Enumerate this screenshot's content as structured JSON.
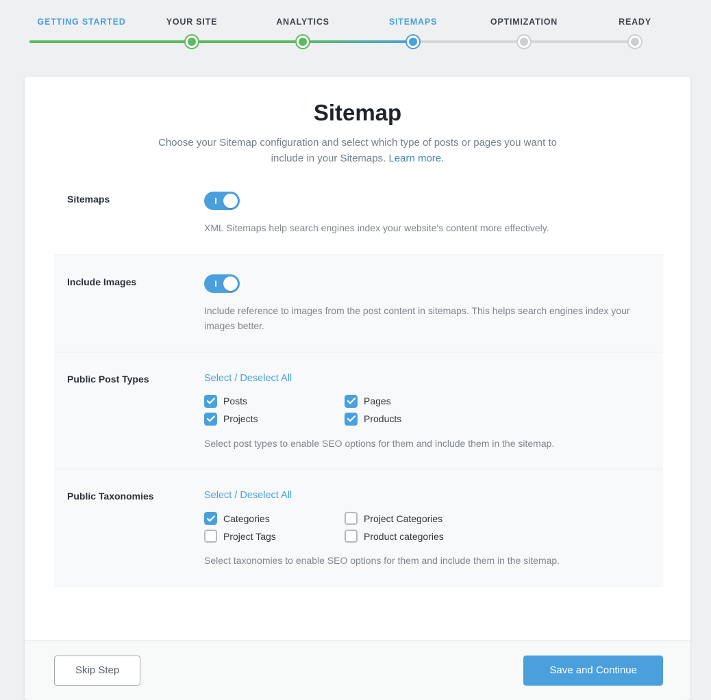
{
  "colors": {
    "accent_blue": "#4aa0dc",
    "progress_green": "#5dba5e",
    "inactive_gray": "#ccd0d4",
    "link_blue": "#4085c5"
  },
  "stepper": {
    "steps": [
      {
        "label": "GETTING STARTED",
        "state": "completed"
      },
      {
        "label": "YOUR SITE",
        "state": "completed"
      },
      {
        "label": "ANALYTICS",
        "state": "completed"
      },
      {
        "label": "SITEMAPS",
        "state": "active"
      },
      {
        "label": "OPTIMIZATION",
        "state": "upcoming"
      },
      {
        "label": "READY",
        "state": "upcoming"
      }
    ]
  },
  "main": {
    "title": "Sitemap",
    "subtitle": "Choose your Sitemap configuration and select which type of posts or pages you want to include in your Sitemaps.",
    "learn_more_label": "Learn more."
  },
  "rows": [
    {
      "label": "Sitemaps",
      "control": "toggle",
      "toggle_on": true,
      "description": "XML Sitemaps help search engines index your website's content more effectively."
    },
    {
      "label": "Include Images",
      "control": "toggle",
      "toggle_on": true,
      "description": "Include reference to images from the post content in sitemaps. This helps search engines index your images better."
    },
    {
      "label": "Public Post Types",
      "control": "checkbox-group",
      "select_all_label": "Select / Deselect All",
      "items": [
        {
          "label": "Posts",
          "checked": true
        },
        {
          "label": "Pages",
          "checked": true
        },
        {
          "label": "Projects",
          "checked": true
        },
        {
          "label": "Products",
          "checked": true
        }
      ],
      "description": "Select post types to enable SEO options for them and include them in the sitemap."
    },
    {
      "label": "Public Taxonomies",
      "control": "checkbox-group",
      "select_all_label": "Select / Deselect All",
      "items": [
        {
          "label": "Categories",
          "checked": true
        },
        {
          "label": "Project Categories",
          "checked": false
        },
        {
          "label": "Project Tags",
          "checked": false
        },
        {
          "label": "Product categories",
          "checked": false
        }
      ],
      "description": "Select taxonomies to enable SEO options for them and include them in the sitemap."
    }
  ],
  "footer": {
    "skip_label": "Skip Step",
    "save_label": "Save and Continue"
  }
}
